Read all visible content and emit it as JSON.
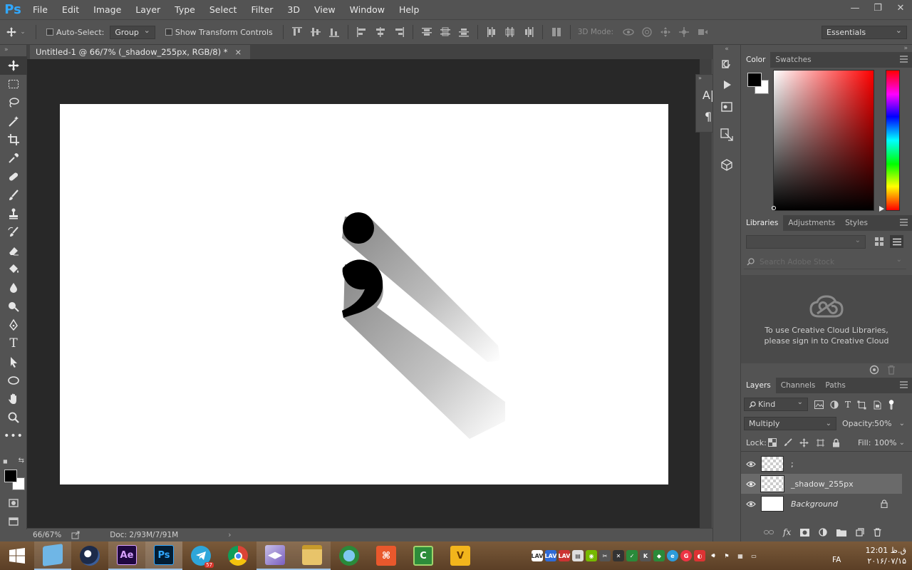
{
  "app": {
    "logo": "Ps"
  },
  "menu": [
    "File",
    "Edit",
    "Image",
    "Layer",
    "Type",
    "Select",
    "Filter",
    "3D",
    "View",
    "Window",
    "Help"
  ],
  "window_controls": {
    "minimize": "—",
    "restore": "❐",
    "close": "✕"
  },
  "options": {
    "auto_select_label": "Auto-Select:",
    "auto_select_value": "Group",
    "show_transform_label": "Show Transform Controls",
    "mode_3d_label": "3D Mode:",
    "workspace": "Essentials"
  },
  "document": {
    "tab_title": "Untitled-1 @ 66/7% (_shadow_255px, RGB/8) *",
    "tab_close": "×",
    "zoom": "66/67%",
    "doc_size": "Doc: 2/93M/7/91M"
  },
  "color_panel": {
    "tabs": [
      "Color",
      "Swatches"
    ],
    "foreground": "#000000",
    "background": "#ffffff"
  },
  "libraries_panel": {
    "tabs": [
      "Libraries",
      "Adjustments",
      "Styles"
    ],
    "search_placeholder": "Search Adobe Stock",
    "message": "To use Creative Cloud Libraries, please sign in to Creative Cloud"
  },
  "layers_panel": {
    "tabs": [
      "Layers",
      "Channels",
      "Paths"
    ],
    "filter_kind": "Kind",
    "blend_mode": "Multiply",
    "opacity_label": "Opacity:",
    "opacity_value": "50%",
    "lock_label": "Lock:",
    "fill_label": "Fill:",
    "fill_value": "100%",
    "layers": [
      {
        "name": ";",
        "selected": false
      },
      {
        "name": "_shadow_255px",
        "selected": true
      },
      {
        "name": "Background",
        "selected": false,
        "locked": true
      }
    ]
  },
  "taskbar": {
    "telegram_badge": "57",
    "apps": [
      "start",
      "notepad",
      "cinema4d",
      "after-effects",
      "photoshop",
      "telegram",
      "chrome",
      "visual-studio",
      "file-explorer",
      "internet-download-manager",
      "acrobat",
      "camtasia",
      "vectr"
    ],
    "language": "FA",
    "time": "ق.ظ 12:01",
    "date": "۲۰۱۶/۰۷/۱۵"
  },
  "accent_colors": {
    "ps_blue": "#31a8ff",
    "panel": "#535353",
    "canvas_bg": "#282828"
  }
}
